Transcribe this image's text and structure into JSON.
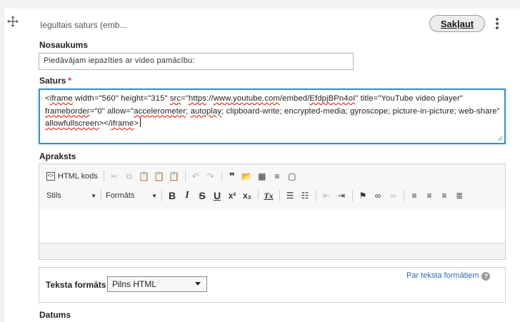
{
  "header": {
    "section_title": "Iegultais saturs (emb...",
    "edit_button": "Sakļaut"
  },
  "fields": {
    "title": {
      "label": "Nosaukums",
      "value": "Piedāvājam iepazīties ar video pamācību:"
    },
    "content": {
      "label": "Saturs",
      "required_mark": "*",
      "parts": [
        {
          "t": "<",
          "sp": false
        },
        {
          "t": "iframe",
          "sp": true
        },
        {
          "t": " width=\"560\" height=\"315\" ",
          "sp": false
        },
        {
          "t": "src",
          "sp": true
        },
        {
          "t": "=\"",
          "sp": false
        },
        {
          "t": "https",
          "sp": true
        },
        {
          "t": "://",
          "sp": false
        },
        {
          "t": "www.youtube.com",
          "sp": true
        },
        {
          "t": "/embed/",
          "sp": false
        },
        {
          "t": "EfdpjBPn4oI",
          "sp": true
        },
        {
          "t": "\" title=\"YouTube video player\" ",
          "sp": false
        },
        {
          "t": "frameborder",
          "sp": true
        },
        {
          "t": "=\"0\" allow=\"",
          "sp": false
        },
        {
          "t": "accelerometer",
          "sp": true
        },
        {
          "t": "; ",
          "sp": false
        },
        {
          "t": "autoplay",
          "sp": true
        },
        {
          "t": "; clipboard-write; encrypted-media; gyroscope; picture-in-picture; web-share\" ",
          "sp": false
        },
        {
          "t": "allowfullscreen",
          "sp": true
        },
        {
          "t": "></",
          "sp": false
        },
        {
          "t": "iframe",
          "sp": true
        },
        {
          "t": ">",
          "sp": false
        }
      ]
    },
    "description": {
      "label": "Apraksts",
      "source_button": "HTML kods",
      "style_combo": "Stils",
      "format_combo": "Formāts"
    },
    "text_format": {
      "label": "Teksta formāts",
      "selected": "Pilns HTML",
      "about_link": "Par teksta formātiem",
      "help_glyph": "?"
    },
    "date": {
      "label": "Datums"
    }
  },
  "icons": {
    "drag": "move-icon",
    "more": "kebab-menu-icon"
  },
  "colors": {
    "accent": "#3b8ed6",
    "required": "#d1242f",
    "link": "#2a6db0"
  }
}
